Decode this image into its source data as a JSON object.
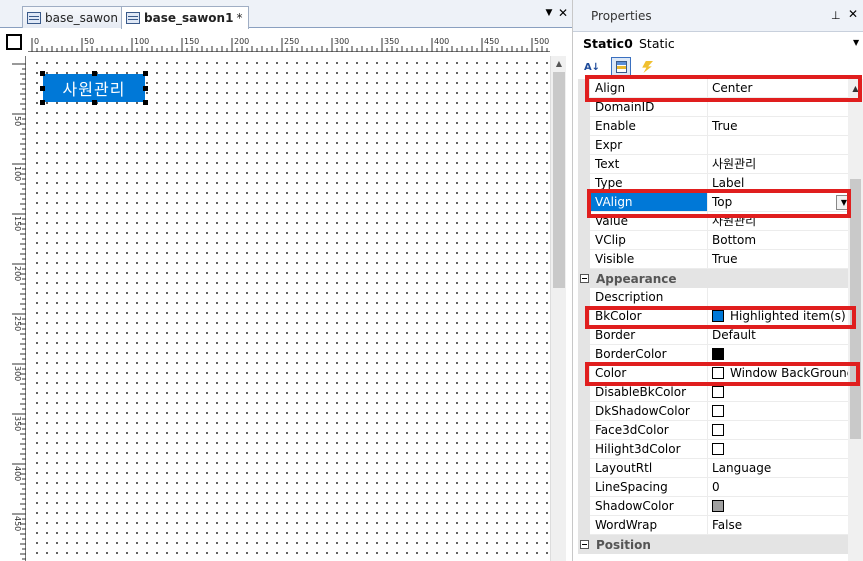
{
  "tabs": [
    {
      "label": "base_sawon",
      "dirty": "*"
    },
    {
      "label": "base_sawon1",
      "dirty": "*"
    }
  ],
  "tab_controls": {
    "menu": "▼",
    "close": "✕"
  },
  "ruler": {
    "h_labels": [
      "0",
      "50",
      "100",
      "150",
      "200",
      "250",
      "300",
      "350",
      "400",
      "450",
      "500"
    ],
    "v_labels": [
      "50",
      "100",
      "150",
      "200",
      "250",
      "300",
      "350",
      "400",
      "450"
    ]
  },
  "static_control": {
    "text": "사원관리",
    "bkcolor": "#0078d7",
    "color": "#ffffff"
  },
  "properties": {
    "title": "Properties",
    "pin": "⊥",
    "close": "✕",
    "object_name": "Static0",
    "object_type": "Static",
    "dropdown": "▼",
    "toolbar": {
      "alpha": "A↓",
      "categorized": "categorized-icon",
      "events": "events-icon"
    },
    "rows": [
      {
        "kind": "prop",
        "name": "Align",
        "value": "Center"
      },
      {
        "kind": "prop",
        "name": "DomainID",
        "value": ""
      },
      {
        "kind": "prop",
        "name": "Enable",
        "value": "True"
      },
      {
        "kind": "prop",
        "name": "Expr",
        "value": ""
      },
      {
        "kind": "prop",
        "name": "Text",
        "value": "사원관리"
      },
      {
        "kind": "prop",
        "name": "Type",
        "value": "Label"
      },
      {
        "kind": "prop",
        "name": "VAlign",
        "value": "Top",
        "selected": true
      },
      {
        "kind": "prop",
        "name": "Value",
        "value": "사원관리"
      },
      {
        "kind": "prop",
        "name": "VClip",
        "value": "Bottom"
      },
      {
        "kind": "prop",
        "name": "Visible",
        "value": "True"
      },
      {
        "kind": "cat",
        "name": "Appearance"
      },
      {
        "kind": "prop",
        "name": "Description",
        "value": ""
      },
      {
        "kind": "prop",
        "name": "BkColor",
        "value": "Highlighted item(s)",
        "swatch": "#0078d7"
      },
      {
        "kind": "prop",
        "name": "Border",
        "value": "Default"
      },
      {
        "kind": "prop",
        "name": "BorderColor",
        "value": "",
        "swatch": "#000000"
      },
      {
        "kind": "prop",
        "name": "Color",
        "value": "Window BackGround",
        "swatch": "#ffffff"
      },
      {
        "kind": "prop",
        "name": "DisableBkColor",
        "value": "",
        "swatch": "#ffffff"
      },
      {
        "kind": "prop",
        "name": "DkShadowColor",
        "value": "",
        "swatch": "#ffffff"
      },
      {
        "kind": "prop",
        "name": "Face3dColor",
        "value": "",
        "swatch": "#ffffff"
      },
      {
        "kind": "prop",
        "name": "Hilight3dColor",
        "value": "",
        "swatch": "#ffffff"
      },
      {
        "kind": "prop",
        "name": "LayoutRtl",
        "value": "Language"
      },
      {
        "kind": "prop",
        "name": "LineSpacing",
        "value": "0"
      },
      {
        "kind": "prop",
        "name": "ShadowColor",
        "value": "",
        "swatch": "#a0a0a0"
      },
      {
        "kind": "prop",
        "name": "WordWrap",
        "value": "False"
      },
      {
        "kind": "cat",
        "name": "Position"
      }
    ]
  },
  "colors": {
    "selection": "#0078d7",
    "highlight_box": "#e01e1e"
  }
}
